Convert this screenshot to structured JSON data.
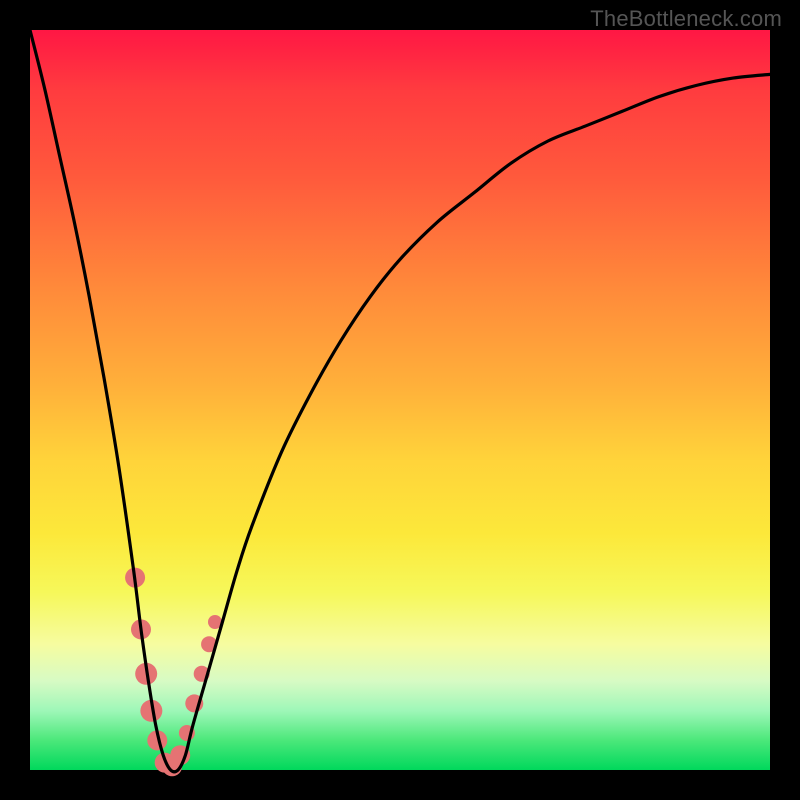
{
  "watermark": "TheBottleneck.com",
  "colors": {
    "curve": "#000000",
    "marker_fill": "#e57373",
    "marker_stroke": "#c85a5a",
    "background_black": "#000000"
  },
  "chart_data": {
    "type": "line",
    "title": "",
    "xlabel": "",
    "ylabel": "",
    "xlim": [
      0,
      100
    ],
    "ylim": [
      0,
      100
    ],
    "grid": false,
    "series": [
      {
        "name": "bottleneck-curve",
        "x": [
          0,
          2,
          4,
          6,
          8,
          10,
          12,
          14,
          15,
          16,
          17,
          18,
          19,
          20,
          21,
          22,
          24,
          26,
          28,
          30,
          34,
          38,
          42,
          46,
          50,
          55,
          60,
          65,
          70,
          75,
          80,
          85,
          90,
          95,
          100
        ],
        "y": [
          100,
          92,
          83,
          74,
          64,
          53,
          41,
          27,
          19,
          12,
          6,
          2,
          0,
          0,
          2,
          6,
          13,
          20,
          27,
          33,
          43,
          51,
          58,
          64,
          69,
          74,
          78,
          82,
          85,
          87,
          89,
          91,
          92.5,
          93.5,
          94
        ]
      }
    ],
    "markers": {
      "name": "highlighted-range",
      "points": [
        {
          "x": 14.2,
          "y": 26,
          "r": 10
        },
        {
          "x": 15.0,
          "y": 19,
          "r": 10
        },
        {
          "x": 15.7,
          "y": 13,
          "r": 11
        },
        {
          "x": 16.4,
          "y": 8,
          "r": 11
        },
        {
          "x": 17.2,
          "y": 4,
          "r": 10
        },
        {
          "x": 18.2,
          "y": 1,
          "r": 10
        },
        {
          "x": 19.2,
          "y": 0.5,
          "r": 10
        },
        {
          "x": 20.3,
          "y": 2,
          "r": 10
        },
        {
          "x": 21.2,
          "y": 5,
          "r": 8
        },
        {
          "x": 22.2,
          "y": 9,
          "r": 9
        },
        {
          "x": 23.2,
          "y": 13,
          "r": 8
        },
        {
          "x": 24.2,
          "y": 17,
          "r": 8
        },
        {
          "x": 25.0,
          "y": 20,
          "r": 7
        }
      ]
    }
  }
}
